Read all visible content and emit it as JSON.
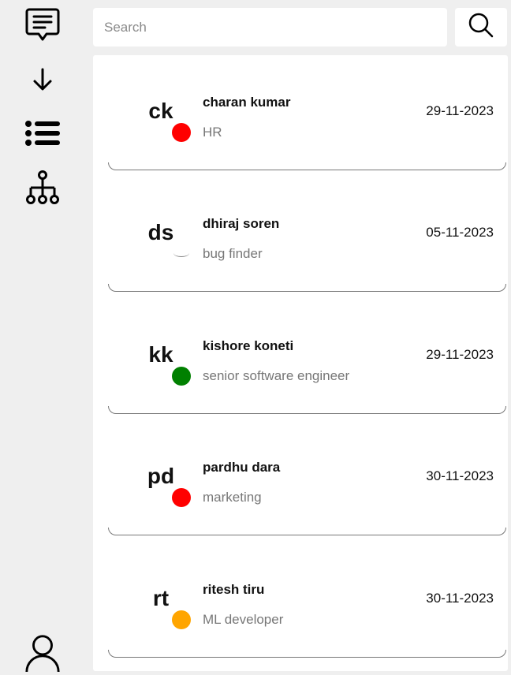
{
  "sidebar": {
    "icons": [
      "chat-note-icon",
      "arrow-down-icon",
      "list-icon",
      "hierarchy-icon",
      "user-icon"
    ]
  },
  "search": {
    "placeholder": "Search",
    "value": ""
  },
  "employees": [
    {
      "initials": "ck",
      "name": "charan kumar",
      "role": "HR",
      "date": "29-11-2023",
      "status_color": "#ff0000"
    },
    {
      "initials": "ds",
      "name": "dhiraj soren",
      "role": "bug finder",
      "date": "05-11-2023",
      "status_color": ""
    },
    {
      "initials": "kk",
      "name": "kishore koneti",
      "role": "senior software engineer",
      "date": "29-11-2023",
      "status_color": "#008000"
    },
    {
      "initials": "pd",
      "name": "pardhu dara",
      "role": "marketing",
      "date": "30-11-2023",
      "status_color": "#ff0000"
    },
    {
      "initials": "rt",
      "name": "ritesh tiru",
      "role": "ML developer",
      "date": "30-11-2023",
      "status_color": "#ffa500"
    }
  ]
}
